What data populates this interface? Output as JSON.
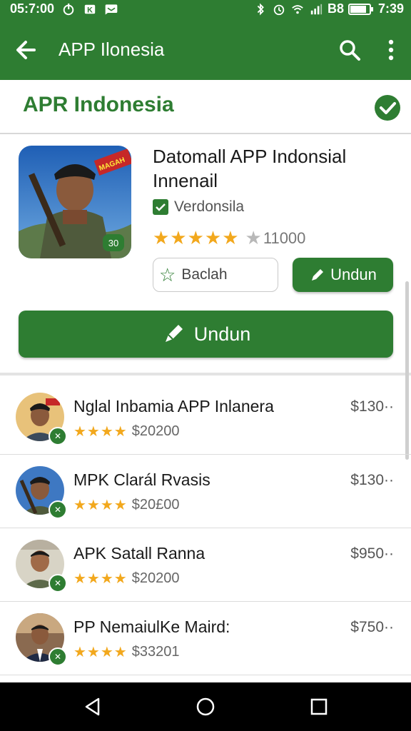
{
  "status_bar": {
    "left_time": "05:7:00",
    "battery": "B8",
    "time": "7:39"
  },
  "appbar": {
    "title": "APP Ilonesia"
  },
  "section": {
    "title": "APR Indonesia"
  },
  "featured": {
    "title": "Datomall APP Indonsial Innenail",
    "developer": "Verdonsila",
    "stars": "★★★★★",
    "rating_count": "11000",
    "wishlist_label": "Baclah",
    "install_label": "Undun",
    "primary_label": "Undun",
    "thumb_text": "MAGAH",
    "thumb_badge": "30"
  },
  "apps": [
    {
      "name": "Nglal Inbamia  APP Inlanera",
      "stars": "★★★★",
      "meta": "$20200",
      "price": "$130··"
    },
    {
      "name": "MPK Clarál Rvasis",
      "stars": "★★★★",
      "meta": "$20£00",
      "price": "$130··"
    },
    {
      "name": "APK Satall Ranna",
      "stars": "★★★★",
      "meta": "$20200",
      "price": "$950··"
    },
    {
      "name": "PP NemaiulKe Maird:",
      "stars": "★★★★",
      "meta": "$33201",
      "price": "$750··"
    }
  ],
  "colors": {
    "primary": "#2e7d32",
    "star": "#f2a81d"
  },
  "icons": [
    "back-arrow-icon",
    "search-icon",
    "more-vert-icon",
    "verified-icon",
    "star-outline-icon",
    "download-icon",
    "nav-back-icon",
    "nav-home-icon",
    "nav-recents-icon"
  ]
}
